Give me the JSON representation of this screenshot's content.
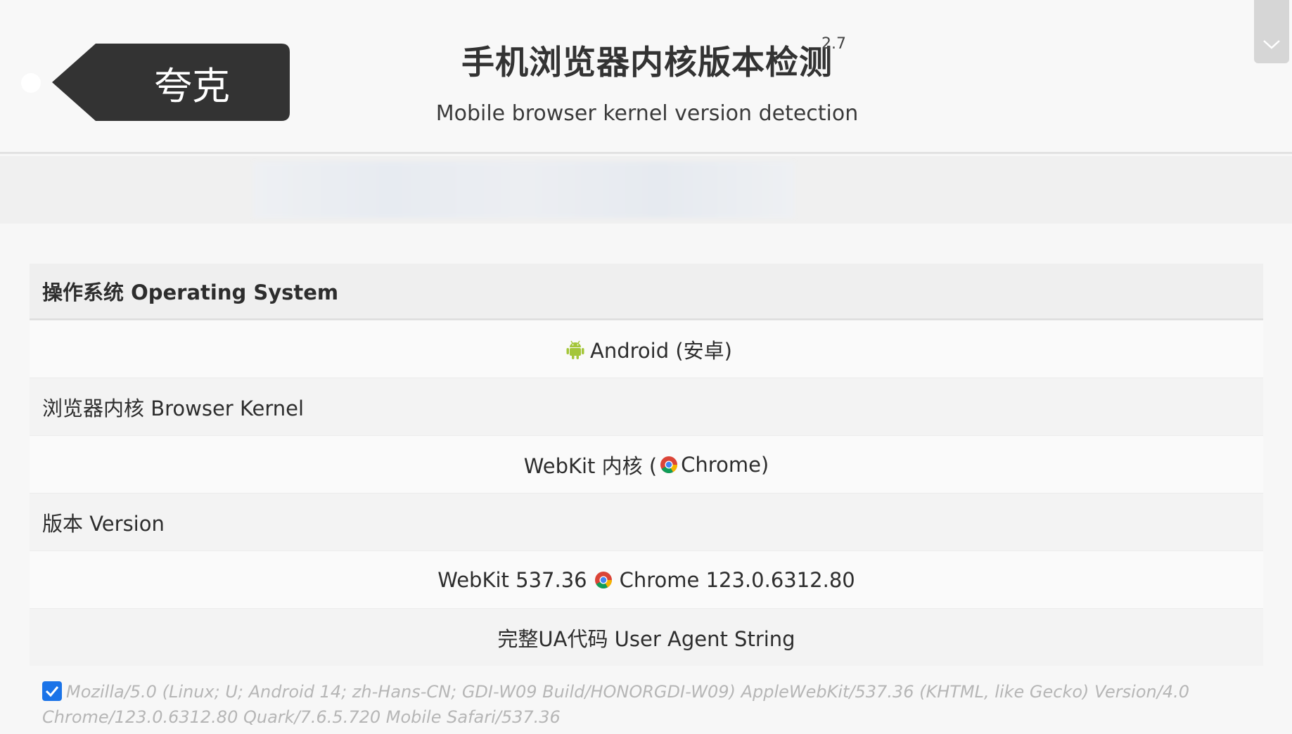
{
  "header": {
    "browser_tag": "夸克",
    "title": "手机浏览器内核版本检测",
    "version": "2.7",
    "subtitle": "Mobile browser kernel version detection"
  },
  "sections": {
    "os_heading": "操作系统 Operating System",
    "os_value": "Android (安卓)",
    "kernel_label": "浏览器内核 Browser Kernel",
    "kernel_value_prefix": "WebKit 内核 (",
    "kernel_value_suffix": "Chrome)",
    "version_label": "版本 Version",
    "version_webkit": "WebKit 537.36",
    "version_chrome": "Chrome 123.0.6312.80",
    "ua_label": "完整UA代码 User Agent String"
  },
  "ua": {
    "checked": true,
    "text": "Mozilla/5.0 (Linux; U; Android 14; zh-Hans-CN; GDI-W09 Build/HONORGDI-W09) AppleWebKit/537.36 (KHTML, like Gecko) Version/4.0 Chrome/123.0.6312.80 Quark/7.6.5.720 Mobile Safari/537.36"
  },
  "icons": {
    "android": "android-icon",
    "chrome": "chrome-icon",
    "scroll": "chevron-down-icon",
    "checkbox": "checkmark-icon"
  },
  "colors": {
    "tag_bg": "#333333",
    "android_green": "#a4c639",
    "checkbox_blue": "#1a73e8"
  }
}
